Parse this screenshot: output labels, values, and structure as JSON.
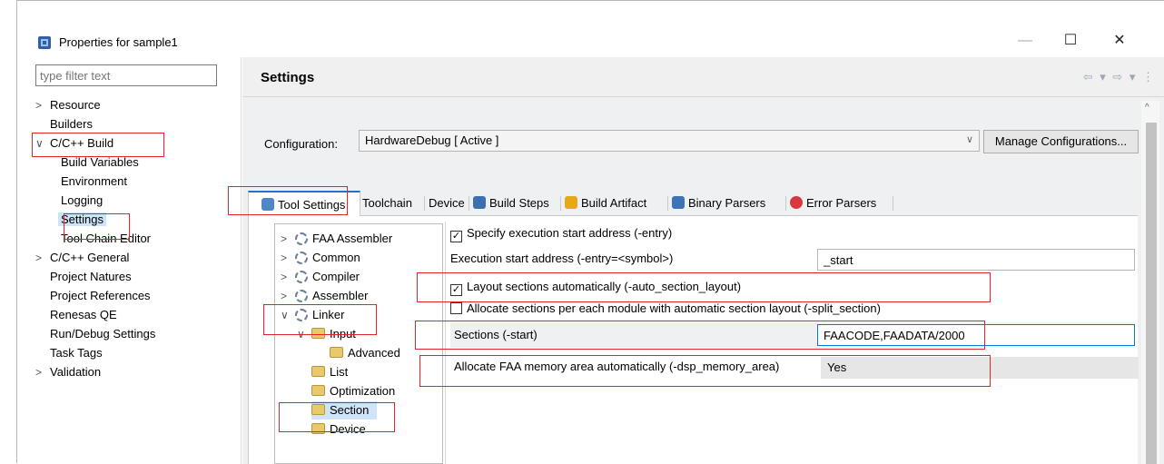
{
  "window": {
    "title": "Properties for sample1",
    "minimize": "—",
    "maximize": "☐",
    "close": "✕"
  },
  "left": {
    "filter_placeholder": "type filter text",
    "tree": [
      {
        "label": "Resource",
        "chevron": ">"
      },
      {
        "label": "Builders",
        "chevron": ""
      },
      {
        "label": "C/C++ Build",
        "chevron": "∨"
      },
      {
        "label": "Build Variables",
        "chevron": ""
      },
      {
        "label": "Environment",
        "chevron": ""
      },
      {
        "label": "Logging",
        "chevron": ""
      },
      {
        "label": "Settings",
        "chevron": ""
      },
      {
        "label": "Tool Chain Editor",
        "chevron": ""
      },
      {
        "label": "C/C++ General",
        "chevron": ">"
      },
      {
        "label": "Project Natures",
        "chevron": ""
      },
      {
        "label": "Project References",
        "chevron": ""
      },
      {
        "label": "Renesas QE",
        "chevron": ""
      },
      {
        "label": "Run/Debug Settings",
        "chevron": ""
      },
      {
        "label": "Task Tags",
        "chevron": ""
      },
      {
        "label": "Validation",
        "chevron": ">"
      }
    ]
  },
  "header": {
    "title": "Settings",
    "nav": "⇦ ▾ ⇨ ▾ ⋮"
  },
  "config": {
    "label": "Configuration:",
    "value": "HardwareDebug  [ Active ]",
    "arrow": "∨",
    "manage_label": "Manage Configurations..."
  },
  "tabs": [
    {
      "label": "Tool Settings",
      "color": "#4f86c6"
    },
    {
      "label": "Toolchain",
      "color": ""
    },
    {
      "label": "Device",
      "color": ""
    },
    {
      "label": "Build Steps",
      "color": "#3c6fb0"
    },
    {
      "label": "Build Artifact",
      "color": "#e6a817"
    },
    {
      "label": "Binary Parsers",
      "color": "#3e73b8"
    },
    {
      "label": "Error Parsers",
      "color": "#d9363e"
    }
  ],
  "subtree": [
    {
      "label": "FAA Assembler",
      "chevron": ">"
    },
    {
      "label": "Common",
      "chevron": ">"
    },
    {
      "label": "Compiler",
      "chevron": ">"
    },
    {
      "label": "Assembler",
      "chevron": ">"
    },
    {
      "label": "Linker",
      "chevron": "∨"
    },
    {
      "label": "Input",
      "chevron": "∨"
    },
    {
      "label": "Advanced",
      "chevron": ""
    },
    {
      "label": "List",
      "chevron": ""
    },
    {
      "label": "Optimization",
      "chevron": ""
    },
    {
      "label": "Section",
      "chevron": ""
    },
    {
      "label": "Device",
      "chevron": ""
    }
  ],
  "options": {
    "entry_check": "Specify execution start address (-entry)",
    "entry_label": "Execution start address (-entry=<symbol>)",
    "entry_value": "_start",
    "auto_layout": "Layout sections automatically (-auto_section_layout)",
    "split_section": "Allocate sections per each module with automatic section layout (-split_section)",
    "sections_label": "Sections (-start)",
    "sections_value": "FAACODE,FAADATA/2000",
    "faa_label": "Allocate FAA memory area automatically (-dsp_memory_area)",
    "faa_value": "Yes",
    "check_mark": "✓"
  }
}
